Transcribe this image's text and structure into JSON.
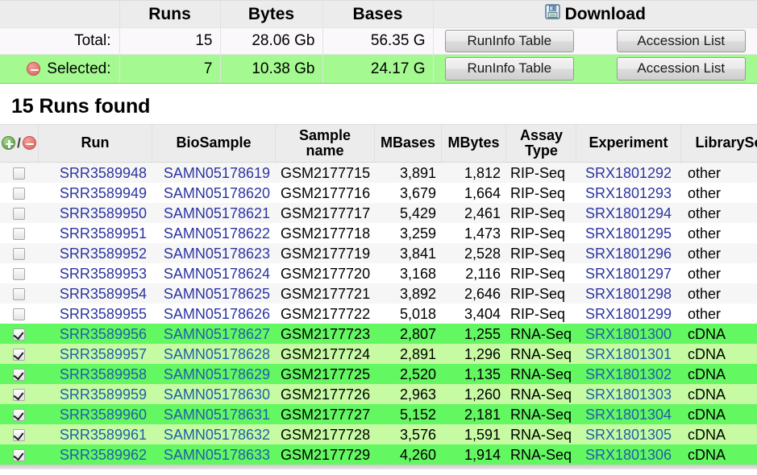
{
  "summary": {
    "columns": [
      "",
      "Runs",
      "Bytes",
      "Bases",
      "Download"
    ],
    "download_header_label": "Download",
    "download_icon": "floppy-disk-save-icon",
    "rows": [
      {
        "label": "Total:",
        "icon": null,
        "runs": "15",
        "bytes": "28.06 Gb",
        "bases": "56.35 G",
        "runinfo_button": "RunInfo Table",
        "accession_button": "Accession List",
        "selected": false
      },
      {
        "label": "Selected:",
        "icon": "minus-circle-icon",
        "runs": "7",
        "bytes": "10.38 Gb",
        "bases": "24.17 G",
        "runinfo_button": "RunInfo Table",
        "accession_button": "Accession List",
        "selected": true
      }
    ]
  },
  "results": {
    "title": "15 Runs found",
    "select_all_icon": "plus-circle-icon",
    "deselect_all_icon": "minus-circle-icon",
    "select_separator": "/",
    "columns": [
      "",
      "Run",
      "BioSample",
      "Sample name",
      "MBases",
      "MBytes",
      "Assay Type",
      "Experiment",
      "LibrarySelection"
    ],
    "rows": [
      {
        "checked": false,
        "run": "SRR3589948",
        "biosample": "SAMN05178619",
        "sample_name": "GSM2177715",
        "mbases": "3,891",
        "mbytes": "1,812",
        "assay_type": "RIP-Seq",
        "experiment": "SRX1801292",
        "library_selection": "other"
      },
      {
        "checked": false,
        "run": "SRR3589949",
        "biosample": "SAMN05178620",
        "sample_name": "GSM2177716",
        "mbases": "3,679",
        "mbytes": "1,664",
        "assay_type": "RIP-Seq",
        "experiment": "SRX1801293",
        "library_selection": "other"
      },
      {
        "checked": false,
        "run": "SRR3589950",
        "biosample": "SAMN05178621",
        "sample_name": "GSM2177717",
        "mbases": "5,429",
        "mbytes": "2,461",
        "assay_type": "RIP-Seq",
        "experiment": "SRX1801294",
        "library_selection": "other"
      },
      {
        "checked": false,
        "run": "SRR3589951",
        "biosample": "SAMN05178622",
        "sample_name": "GSM2177718",
        "mbases": "3,259",
        "mbytes": "1,473",
        "assay_type": "RIP-Seq",
        "experiment": "SRX1801295",
        "library_selection": "other"
      },
      {
        "checked": false,
        "run": "SRR3589952",
        "biosample": "SAMN05178623",
        "sample_name": "GSM2177719",
        "mbases": "3,841",
        "mbytes": "2,528",
        "assay_type": "RIP-Seq",
        "experiment": "SRX1801296",
        "library_selection": "other"
      },
      {
        "checked": false,
        "run": "SRR3589953",
        "biosample": "SAMN05178624",
        "sample_name": "GSM2177720",
        "mbases": "3,168",
        "mbytes": "2,116",
        "assay_type": "RIP-Seq",
        "experiment": "SRX1801297",
        "library_selection": "other"
      },
      {
        "checked": false,
        "run": "SRR3589954",
        "biosample": "SAMN05178625",
        "sample_name": "GSM2177721",
        "mbases": "3,892",
        "mbytes": "2,646",
        "assay_type": "RIP-Seq",
        "experiment": "SRX1801298",
        "library_selection": "other"
      },
      {
        "checked": false,
        "run": "SRR3589955",
        "biosample": "SAMN05178626",
        "sample_name": "GSM2177722",
        "mbases": "5,018",
        "mbytes": "3,404",
        "assay_type": "RIP-Seq",
        "experiment": "SRX1801299",
        "library_selection": "other"
      },
      {
        "checked": true,
        "run": "SRR3589956",
        "biosample": "SAMN05178627",
        "sample_name": "GSM2177723",
        "mbases": "2,807",
        "mbytes": "1,255",
        "assay_type": "RNA-Seq",
        "experiment": "SRX1801300",
        "library_selection": "cDNA"
      },
      {
        "checked": true,
        "run": "SRR3589957",
        "biosample": "SAMN05178628",
        "sample_name": "GSM2177724",
        "mbases": "2,891",
        "mbytes": "1,296",
        "assay_type": "RNA-Seq",
        "experiment": "SRX1801301",
        "library_selection": "cDNA"
      },
      {
        "checked": true,
        "run": "SRR3589958",
        "biosample": "SAMN05178629",
        "sample_name": "GSM2177725",
        "mbases": "2,520",
        "mbytes": "1,135",
        "assay_type": "RNA-Seq",
        "experiment": "SRX1801302",
        "library_selection": "cDNA"
      },
      {
        "checked": true,
        "run": "SRR3589959",
        "biosample": "SAMN05178630",
        "sample_name": "GSM2177726",
        "mbases": "2,963",
        "mbytes": "1,260",
        "assay_type": "RNA-Seq",
        "experiment": "SRX1801303",
        "library_selection": "cDNA"
      },
      {
        "checked": true,
        "run": "SRR3589960",
        "biosample": "SAMN05178631",
        "sample_name": "GSM2177727",
        "mbases": "5,152",
        "mbytes": "2,181",
        "assay_type": "RNA-Seq",
        "experiment": "SRX1801304",
        "library_selection": "cDNA"
      },
      {
        "checked": true,
        "run": "SRR3589961",
        "biosample": "SAMN05178632",
        "sample_name": "GSM2177728",
        "mbases": "3,576",
        "mbytes": "1,591",
        "assay_type": "RNA-Seq",
        "experiment": "SRX1801305",
        "library_selection": "cDNA"
      },
      {
        "checked": true,
        "run": "SRR3589962",
        "biosample": "SAMN05178633",
        "sample_name": "GSM2177729",
        "mbases": "4,260",
        "mbytes": "1,914",
        "assay_type": "RNA-Seq",
        "experiment": "SRX1801306",
        "library_selection": "cDNA"
      }
    ]
  },
  "colors": {
    "selected_summary_bg": "#a4f990",
    "selected_row_bright": "#63f762",
    "selected_row_light": "#c6fba3",
    "link": "#2b35a0",
    "header_bg": "#ececed",
    "plus_icon": "#6aab52",
    "minus_icon": "#d9534f"
  }
}
